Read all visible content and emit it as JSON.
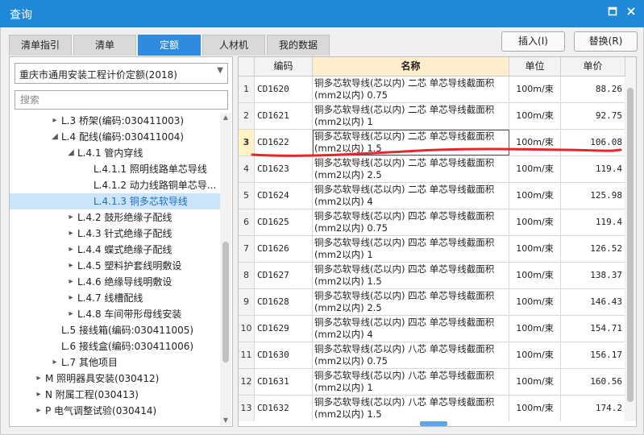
{
  "window": {
    "title": "查询",
    "maximize_icon": "maximize-icon",
    "close_icon": "close-icon"
  },
  "tabs": [
    {
      "label": "清单指引",
      "active": false
    },
    {
      "label": "清单",
      "active": false
    },
    {
      "label": "定额",
      "active": true
    },
    {
      "label": "人材机",
      "active": false
    },
    {
      "label": "我的数据",
      "active": false
    }
  ],
  "actions": {
    "insert_label": "插入(I)",
    "replace_label": "替换(R)"
  },
  "library": {
    "selected": "重庆市通用安装工程计价定额(2018)"
  },
  "search": {
    "placeholder": "搜索",
    "value": ""
  },
  "tree": [
    {
      "label": "L.3 桥架(编码:030411003)",
      "level": 3,
      "toggle": "right",
      "selected": false
    },
    {
      "label": "L.4 配线(编码:030411004)",
      "level": 3,
      "toggle": "down",
      "selected": false
    },
    {
      "label": "L.4.1 管内穿线",
      "level": 4,
      "toggle": "down",
      "selected": false
    },
    {
      "label": "L.4.1.1 照明线路单芯导线",
      "level": 5,
      "toggle": "",
      "selected": false
    },
    {
      "label": "L.4.1.2 动力线路铜单芯导...",
      "level": 5,
      "toggle": "",
      "selected": false
    },
    {
      "label": "L.4.1.3 铜多芯软导线",
      "level": 5,
      "toggle": "",
      "selected": true
    },
    {
      "label": "L.4.2 鼓形绝缘子配线",
      "level": 4,
      "toggle": "right",
      "selected": false
    },
    {
      "label": "L.4.3 针式绝缘子配线",
      "level": 4,
      "toggle": "right",
      "selected": false
    },
    {
      "label": "L.4.4 蝶式绝缘子配线",
      "level": 4,
      "toggle": "right",
      "selected": false
    },
    {
      "label": "L.4.5 塑料护套线明敷设",
      "level": 4,
      "toggle": "right",
      "selected": false
    },
    {
      "label": "L.4.6 绝缘导线明敷设",
      "level": 4,
      "toggle": "right",
      "selected": false
    },
    {
      "label": "L.4.7 线槽配线",
      "level": 4,
      "toggle": "right",
      "selected": false
    },
    {
      "label": "L.4.8 车间带形母线安装",
      "level": 4,
      "toggle": "right",
      "selected": false
    },
    {
      "label": "L.5 接线箱(编码:030411005)",
      "level": 3,
      "toggle": "",
      "selected": false
    },
    {
      "label": "L.6 接线盒(编码:030411006)",
      "level": 3,
      "toggle": "",
      "selected": false
    },
    {
      "label": "L.7 其他项目",
      "level": 3,
      "toggle": "right",
      "selected": false
    },
    {
      "label": "M 照明器具安装(030412)",
      "level": 2,
      "toggle": "right",
      "selected": false
    },
    {
      "label": "N 附属工程(030413)",
      "level": 2,
      "toggle": "right",
      "selected": false
    },
    {
      "label": "P 电气调整试验(030414)",
      "level": 2,
      "toggle": "right",
      "selected": false
    }
  ],
  "grid": {
    "headers": {
      "code": "编码",
      "name": "名称",
      "unit": "单位",
      "price": "单价"
    },
    "current_row": 3,
    "rows": [
      {
        "n": "1",
        "code": "CD1620",
        "name": "铜多芯软导线(芯以内) 二芯 单芯导线截面积(mm2以内) 0.75",
        "unit": "100m/束",
        "price": "88.26"
      },
      {
        "n": "2",
        "code": "CD1621",
        "name": "铜多芯软导线(芯以内) 二芯 单芯导线截面积(mm2以内) 1",
        "unit": "100m/束",
        "price": "92.75"
      },
      {
        "n": "3",
        "code": "CD1622",
        "name": "铜多芯软导线(芯以内) 二芯 单芯导线截面积(mm2以内) 1.5",
        "unit": "100m/束",
        "price": "106.08"
      },
      {
        "n": "4",
        "code": "CD1623",
        "name": "铜多芯软导线(芯以内) 二芯 单芯导线截面积(mm2以内) 2.5",
        "unit": "100m/束",
        "price": "119.4"
      },
      {
        "n": "5",
        "code": "CD1624",
        "name": "铜多芯软导线(芯以内) 二芯 单芯导线截面积(mm2以内) 4",
        "unit": "100m/束",
        "price": "125.98"
      },
      {
        "n": "6",
        "code": "CD1625",
        "name": "铜多芯软导线(芯以内) 四芯 单芯导线截面积(mm2以内) 0.75",
        "unit": "100m/束",
        "price": "119.4"
      },
      {
        "n": "7",
        "code": "CD1626",
        "name": "铜多芯软导线(芯以内) 四芯 单芯导线截面积(mm2以内) 1",
        "unit": "100m/束",
        "price": "126.52"
      },
      {
        "n": "8",
        "code": "CD1627",
        "name": "铜多芯软导线(芯以内) 四芯 单芯导线截面积(mm2以内) 1.5",
        "unit": "100m/束",
        "price": "138.37"
      },
      {
        "n": "9",
        "code": "CD1628",
        "name": "铜多芯软导线(芯以内) 四芯 单芯导线截面积(mm2以内) 2.5",
        "unit": "100m/束",
        "price": "146.43"
      },
      {
        "n": "10",
        "code": "CD1629",
        "name": "铜多芯软导线(芯以内) 四芯 单芯导线截面积(mm2以内) 4",
        "unit": "100m/束",
        "price": "154.71"
      },
      {
        "n": "11",
        "code": "CD1630",
        "name": "铜多芯软导线(芯以内) 八芯 单芯导线截面积(mm2以内) 0.75",
        "unit": "100m/束",
        "price": "156.17"
      },
      {
        "n": "12",
        "code": "CD1631",
        "name": "铜多芯软导线(芯以内) 八芯 单芯导线截面积(mm2以内) 1",
        "unit": "100m/束",
        "price": "160.56"
      },
      {
        "n": "13",
        "code": "CD1632",
        "name": "铜多芯软导线(芯以内) 八芯 单芯导线截面积(mm2以内) 1.5",
        "unit": "100m/束",
        "price": "174.2"
      }
    ]
  },
  "annotation": {
    "color": "#e5262b"
  }
}
